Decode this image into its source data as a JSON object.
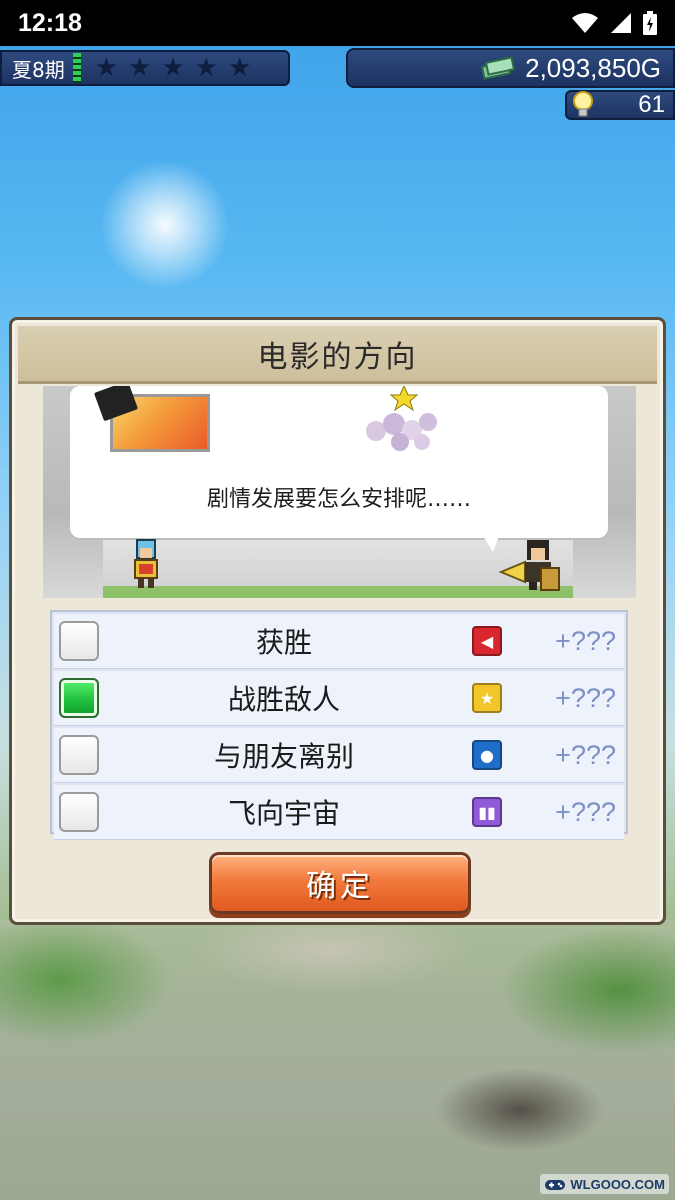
{
  "status_bar": {
    "time": "12:18",
    "icons": [
      "wifi-icon",
      "signal-icon",
      "battery-icon"
    ]
  },
  "hud": {
    "period": "夏8期",
    "star_rating": 0,
    "star_count": 5,
    "money": "2,093,850G",
    "ideas": "61"
  },
  "dialog": {
    "title": "电影的方向",
    "speech": "剧情发展要怎么安排呢……",
    "options": [
      {
        "label": "获胜",
        "bonus": "+???",
        "checked": false,
        "icon": "megaphone-icon",
        "icon_color": "#d8272e"
      },
      {
        "label": "战胜敌人",
        "bonus": "+???",
        "checked": true,
        "icon": "star-icon",
        "icon_color": "#f2c52a"
      },
      {
        "label": "与朋友离别",
        "bonus": "+???",
        "checked": false,
        "icon": "person-icon",
        "icon_color": "#1f6fc9"
      },
      {
        "label": "飞向宇宙",
        "bonus": "+???",
        "checked": false,
        "icon": "alien-icon",
        "icon_color": "#8f5ad6"
      }
    ],
    "confirm_label": "确定"
  },
  "watermark": {
    "text": "WLGOOO.COM"
  }
}
